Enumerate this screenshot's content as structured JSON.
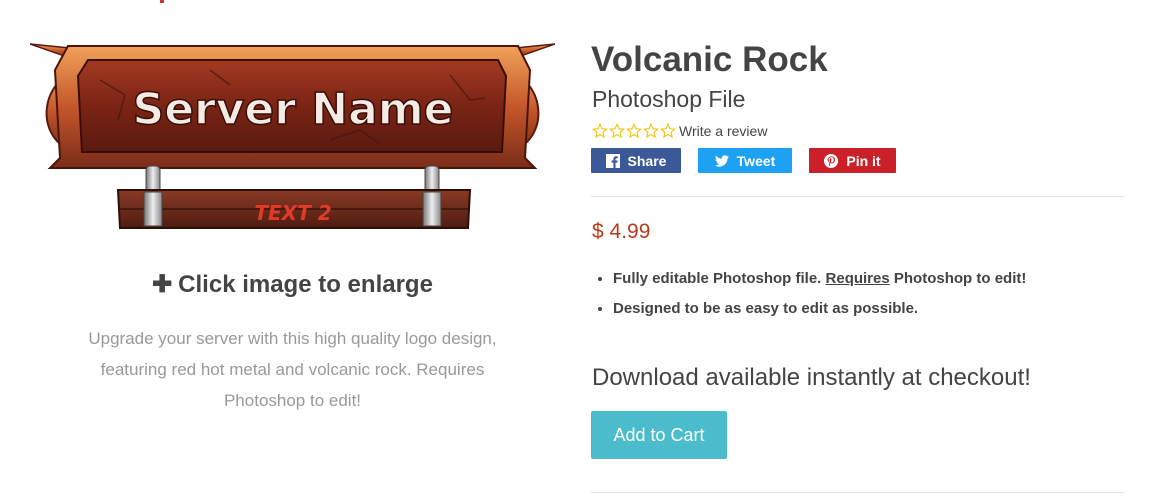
{
  "product": {
    "title": "Volcanic Rock",
    "subtitle": "Photoshop File",
    "review_link": "Write a review",
    "star_count": 5,
    "price": "$ 4.99",
    "features": [
      {
        "before": "Fully editable Photoshop file. ",
        "underlined": "Requires",
        "after": " Photoshop to edit!"
      },
      {
        "before": "Designed to be as easy to edit as possible.",
        "underlined": "",
        "after": ""
      }
    ],
    "download_note": "Download available instantly at checkout!",
    "add_to_cart": "Add to Cart"
  },
  "share": {
    "facebook": "Share",
    "twitter": "Tweet",
    "pinterest": "Pin it"
  },
  "image_panel": {
    "sign_title": "Server Name",
    "sign_subtitle": "TEXT 2",
    "enlarge_label": "Click image to enlarge",
    "description": "Upgrade your server with this high quality logo design, featuring red hot metal and volcanic rock. Requires Photoshop to edit!"
  },
  "colors": {
    "facebook": "#3b5998",
    "twitter": "#1da1f2",
    "pinterest": "#cb2027",
    "price": "#b83a1b",
    "cart_button": "#4abccb"
  }
}
